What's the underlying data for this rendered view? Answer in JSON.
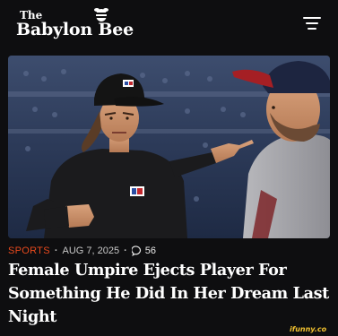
{
  "header": {
    "logo_small": "The",
    "logo_name": "Babylon Bee",
    "logo_icon": "bee-icon",
    "menu_icon": "hamburger-menu-icon"
  },
  "article": {
    "category": "SPORTS",
    "date": "AUG 7, 2025",
    "comment_icon": "comment-bubble-icon",
    "comment_count": "56",
    "headline": "Female Umpire Ejects Player For Something He Did In Her Dream Last Night"
  },
  "watermark": "ifunny.co",
  "colors": {
    "background": "#0e0e10",
    "category": "#e8491d",
    "watermark": "#f2c230"
  }
}
